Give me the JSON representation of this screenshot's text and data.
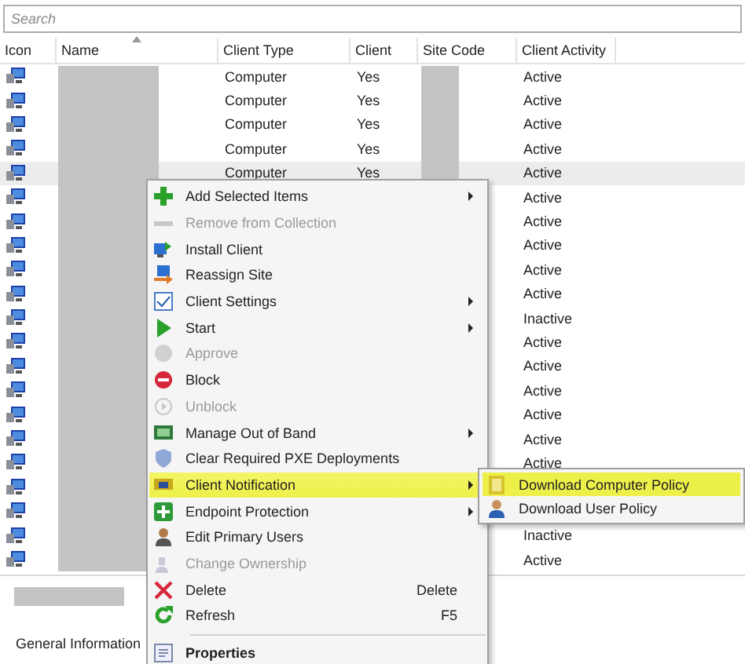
{
  "search": {
    "placeholder": "Search"
  },
  "columns": [
    {
      "label": "Icon",
      "sorted": false
    },
    {
      "label": "Name",
      "sorted": true
    },
    {
      "label": "Client Type",
      "sorted": false
    },
    {
      "label": "Client",
      "sorted": false
    },
    {
      "label": "Site Code",
      "sorted": false
    },
    {
      "label": "Client Activity",
      "sorted": false
    }
  ],
  "rows": [
    {
      "client_type": "Computer",
      "client": "Yes",
      "activity": "Active",
      "selected": false
    },
    {
      "client_type": "Computer",
      "client": "Yes",
      "activity": "Active",
      "selected": false
    },
    {
      "client_type": "Computer",
      "client": "Yes",
      "activity": "Active",
      "selected": false
    },
    {
      "client_type": "Computer",
      "client": "Yes",
      "activity": "Active",
      "selected": false
    },
    {
      "client_type": "Computer",
      "client": "Yes",
      "activity": "Active",
      "selected": true
    },
    {
      "activity": "Active",
      "selected": false
    },
    {
      "activity": "Active",
      "selected": false
    },
    {
      "activity": "Active",
      "selected": false
    },
    {
      "activity": "Active",
      "selected": false
    },
    {
      "activity": "Active",
      "selected": false
    },
    {
      "activity": "Inactive",
      "selected": false
    },
    {
      "activity": "Active",
      "selected": false
    },
    {
      "activity": "Active",
      "selected": false
    },
    {
      "activity": "Active",
      "selected": false
    },
    {
      "activity": "Active",
      "selected": false
    },
    {
      "activity": "Active",
      "selected": false
    },
    {
      "activity": "Active",
      "selected": false
    },
    {
      "selected": false
    },
    {
      "selected": false
    },
    {
      "activity": "Inactive",
      "selected": false
    },
    {
      "activity": "Active",
      "selected": false
    }
  ],
  "context_menu": [
    {
      "label": "Add Selected Items",
      "disabled": false,
      "submenu": true,
      "highlighted": false
    },
    {
      "label": "Remove from Collection",
      "disabled": true,
      "submenu": false,
      "highlighted": false
    },
    {
      "label": "Install Client",
      "disabled": false,
      "submenu": false,
      "highlighted": false
    },
    {
      "label": "Reassign Site",
      "disabled": false,
      "submenu": false,
      "highlighted": false
    },
    {
      "label": "Client Settings",
      "disabled": false,
      "submenu": true,
      "highlighted": false
    },
    {
      "label": "Start",
      "disabled": false,
      "submenu": true,
      "highlighted": false
    },
    {
      "label": "Approve",
      "disabled": true,
      "submenu": false,
      "highlighted": false
    },
    {
      "label": "Block",
      "disabled": false,
      "submenu": false,
      "highlighted": false
    },
    {
      "label": "Unblock",
      "disabled": true,
      "submenu": false,
      "highlighted": false
    },
    {
      "label": "Manage Out of Band",
      "disabled": false,
      "submenu": true,
      "highlighted": false
    },
    {
      "label": "Clear Required PXE Deployments",
      "disabled": false,
      "submenu": false,
      "highlighted": false
    },
    {
      "label": "Client Notification",
      "disabled": false,
      "submenu": true,
      "highlighted": true
    },
    {
      "label": "Endpoint Protection",
      "disabled": false,
      "submenu": true,
      "highlighted": false
    },
    {
      "label": "Edit Primary Users",
      "disabled": false,
      "submenu": false,
      "highlighted": false
    },
    {
      "label": "Change Ownership",
      "disabled": true,
      "submenu": false,
      "highlighted": false
    },
    {
      "label": "Delete",
      "disabled": false,
      "submenu": false,
      "highlighted": false,
      "shortcut": "Delete"
    },
    {
      "label": "Refresh",
      "disabled": false,
      "submenu": false,
      "highlighted": false,
      "shortcut": "F5"
    },
    {
      "label": "Properties",
      "disabled": false,
      "submenu": false,
      "highlighted": false,
      "bold": true,
      "separator_before": true
    }
  ],
  "submenu": [
    {
      "label": "Download Computer Policy",
      "highlighted": true
    },
    {
      "label": "Download User Policy",
      "highlighted": false
    }
  ],
  "details_tab": {
    "label": "General Information"
  }
}
